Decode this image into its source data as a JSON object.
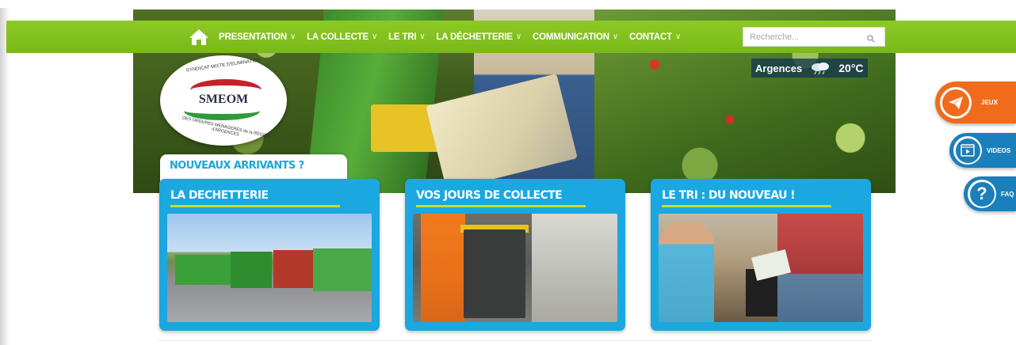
{
  "nav": {
    "items": [
      {
        "label": "PRESENTATION",
        "chevron": "∨"
      },
      {
        "label": "LA COLLECTE",
        "chevron": "∨"
      },
      {
        "label": "LE TRI",
        "chevron": "∨"
      },
      {
        "label": "LA DÉCHETTERIE",
        "chevron": "∨"
      },
      {
        "label": "COMMUNICATION",
        "chevron": "∨"
      },
      {
        "label": "CONTACT",
        "chevron": "∨"
      }
    ],
    "search_placeholder": "Recherche...",
    "home_icon": "home-icon",
    "search_icon": "search-icon"
  },
  "weather": {
    "city": "Argences",
    "temp": "20°C",
    "icon": "cloud-rain-icon"
  },
  "logo": {
    "name": "SMEOM",
    "top_text": "SYNDICAT MIXTE D'ELIMINATION",
    "bottom_text": "DES ORDURES MENAGERES de la REGION d'ARGENCES",
    "colors": {
      "red": "#c8202a",
      "green": "#2f9a3a"
    }
  },
  "arrivals": {
    "label": "NOUVEAUX ARRIVANTS ?"
  },
  "cards": [
    {
      "title": "LA DECHETTERIE"
    },
    {
      "title": "VOS JOURS DE COLLECTE"
    },
    {
      "title": "LE TRI : DU NOUVEAU !"
    }
  ],
  "side": {
    "jeux": "JEUX",
    "videos": "VIDEOS",
    "faq": "FAQ"
  },
  "colors": {
    "nav_green": "#8dca25",
    "card_blue": "#1ba7df",
    "underline_lime": "#c6dd2e",
    "jeux_orange": "#f06c1c",
    "side_blue": "#1b7fbc"
  }
}
